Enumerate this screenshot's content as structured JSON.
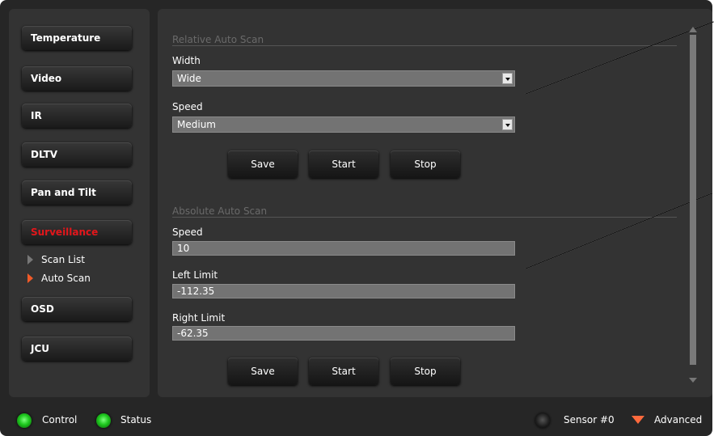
{
  "sidebar": {
    "items": [
      {
        "label": "Temperature"
      },
      {
        "label": "Video"
      },
      {
        "label": "IR"
      },
      {
        "label": "DLTV"
      },
      {
        "label": "Pan and Tilt"
      },
      {
        "label": "Surveillance",
        "active": true
      },
      {
        "label": "OSD"
      },
      {
        "label": "JCU"
      }
    ],
    "subitems": [
      {
        "label": "Scan List",
        "selected": false
      },
      {
        "label": "Auto Scan",
        "selected": true
      }
    ],
    "active_color": "#e3161b"
  },
  "relative": {
    "title": "Relative Auto Scan",
    "width_label": "Width",
    "width_value": "Wide",
    "speed_label": "Speed",
    "speed_value": "Medium",
    "save": "Save",
    "start": "Start",
    "stop": "Stop"
  },
  "absolute": {
    "title": "Absolute Auto Scan",
    "speed_label": "Speed",
    "speed_value": "10",
    "left_label": "Left Limit",
    "left_value": "-112.35",
    "right_label": "Right Limit",
    "right_value": "-62.35",
    "save": "Save",
    "start": "Start",
    "stop": "Stop"
  },
  "status": {
    "control": "Control",
    "status": "Status",
    "sensor": "Sensor #0",
    "advanced": "Advanced",
    "led_color": "#1ec81e",
    "advanced_color": "#ff6a3d"
  }
}
